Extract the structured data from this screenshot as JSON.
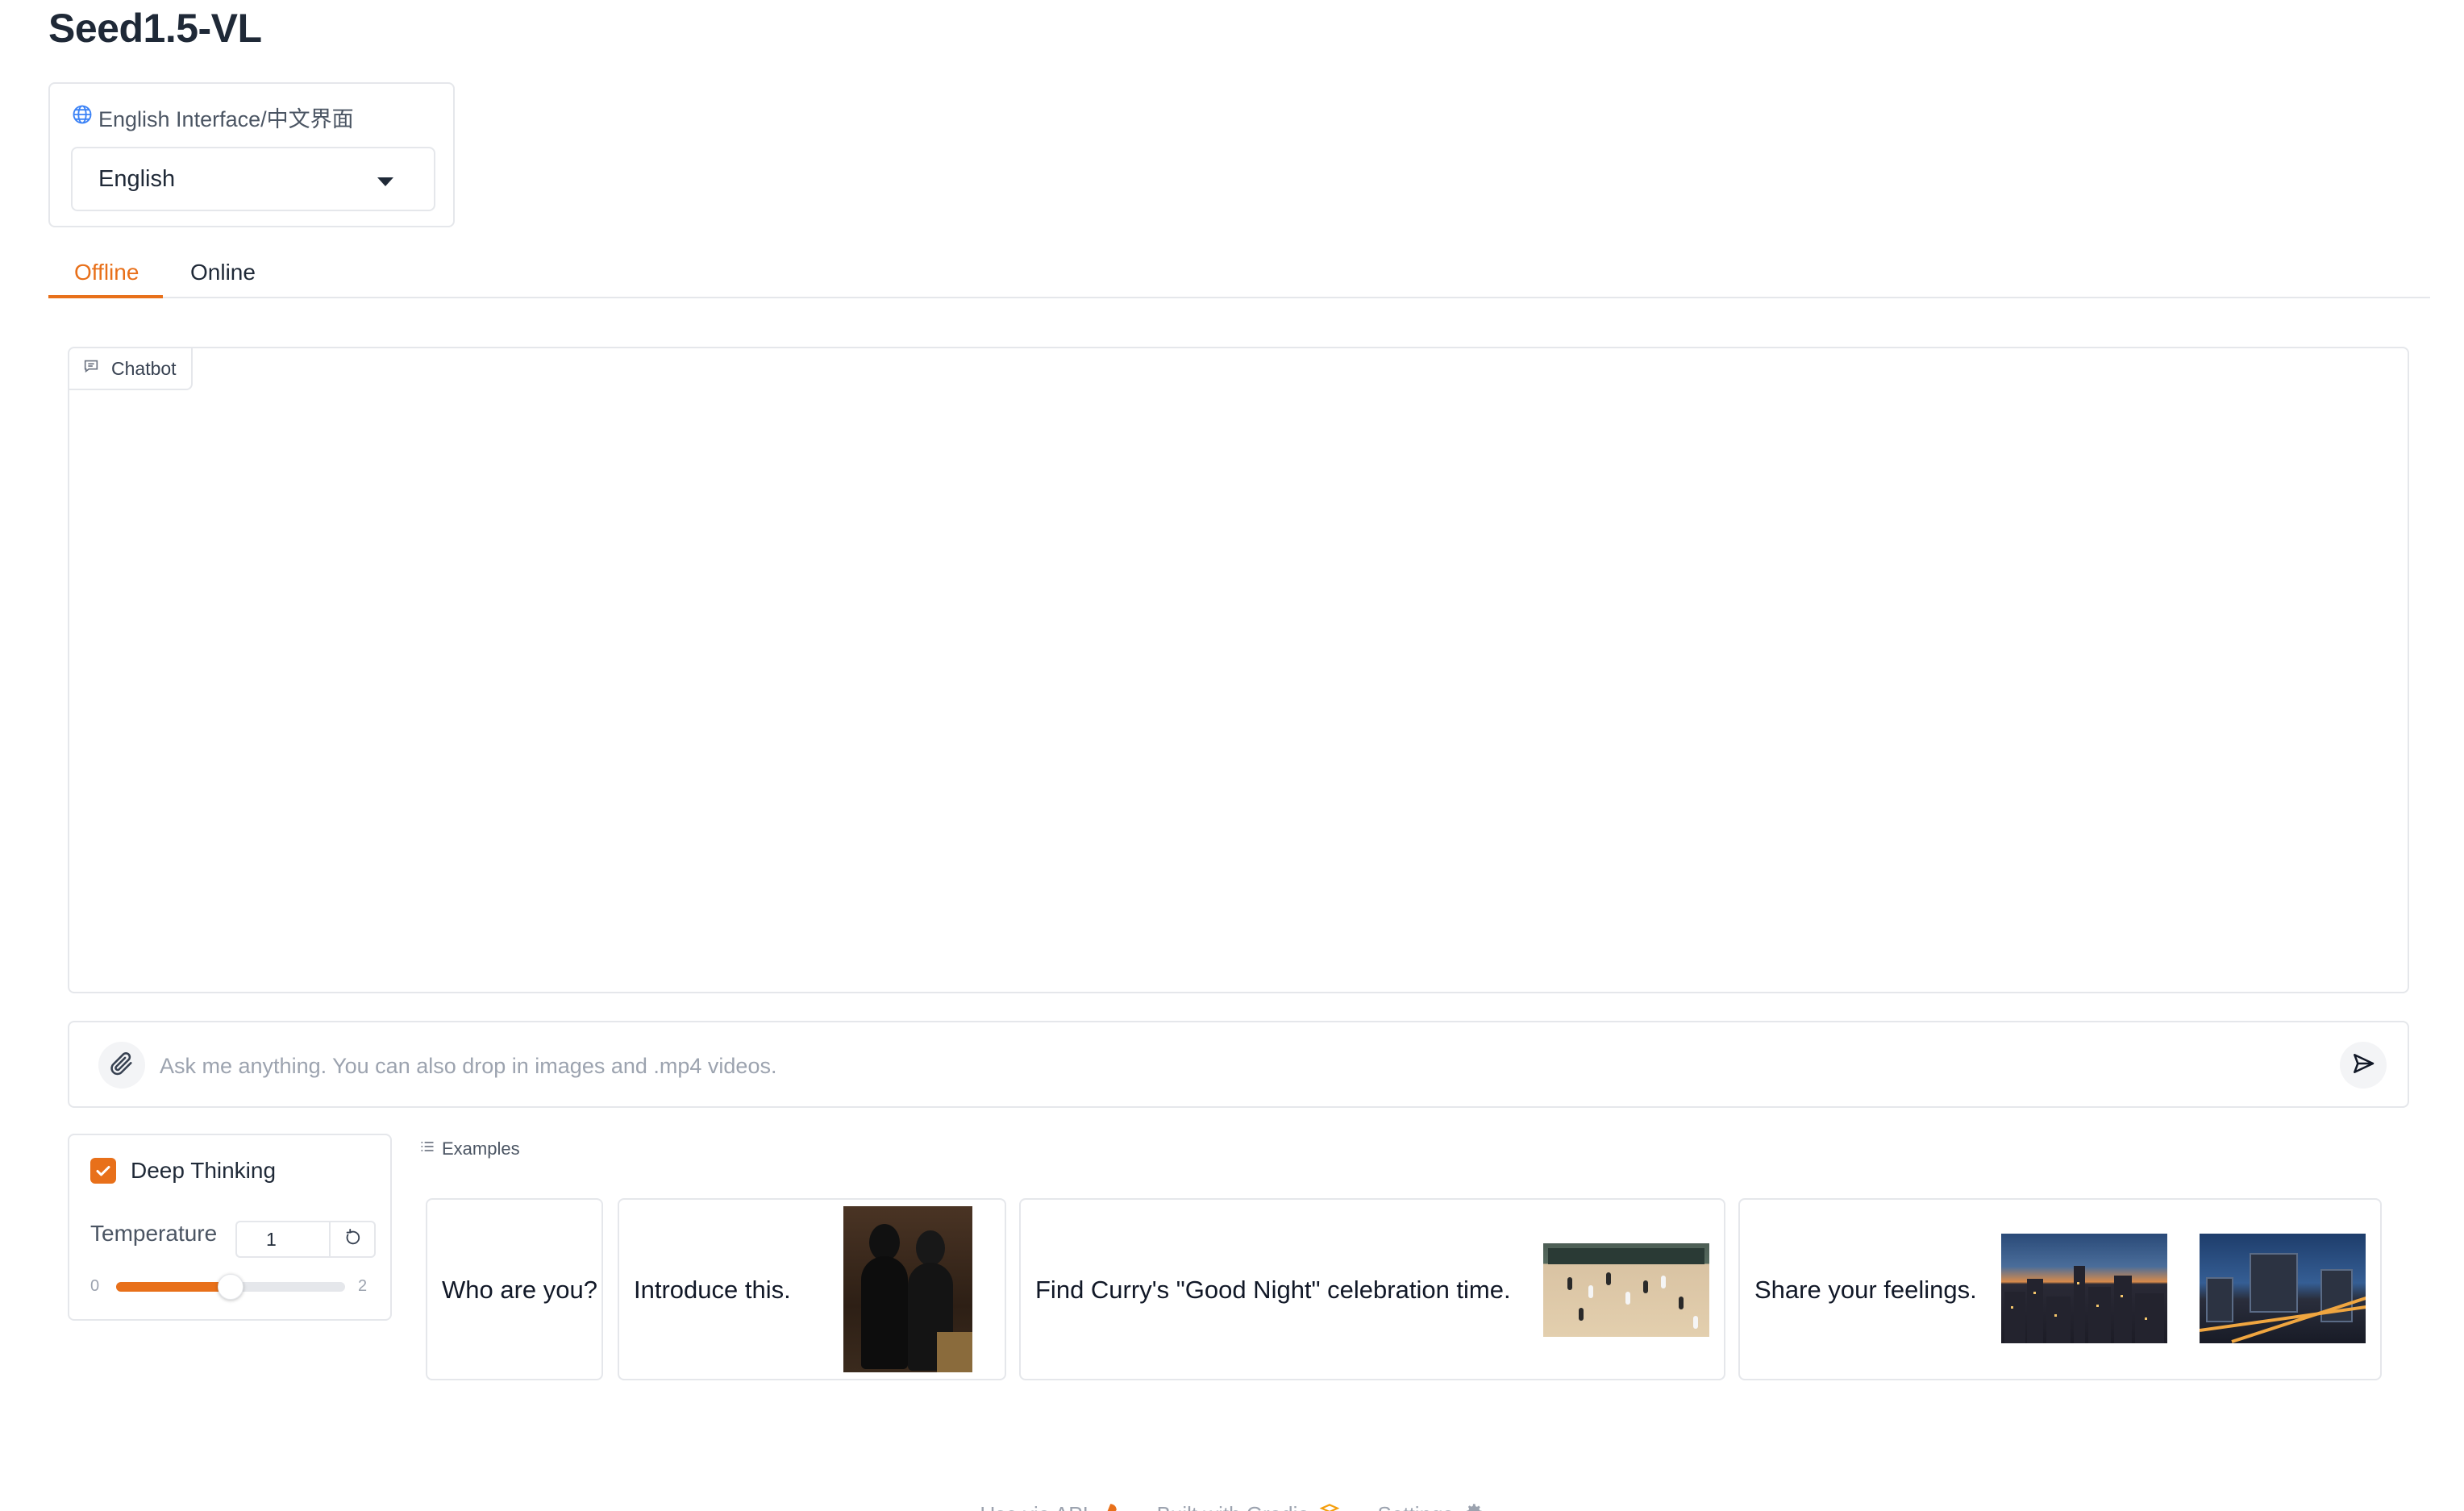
{
  "app": {
    "title": "Seed1.5-VL"
  },
  "language": {
    "label": "English Interface/中文界面",
    "selected": "English",
    "icon": "globe-icon"
  },
  "tabs": [
    {
      "label": "Offline",
      "active": true
    },
    {
      "label": "Online",
      "active": false
    }
  ],
  "chatbot": {
    "label": "Chatbot",
    "icon": "chat-bubble-icon"
  },
  "input": {
    "placeholder": "Ask me anything. You can also drop in images and .mp4 videos.",
    "value": "",
    "attach_icon": "paperclip-icon",
    "send_icon": "send-icon"
  },
  "settings": {
    "deep_thinking_label": "Deep Thinking",
    "deep_thinking_checked": true,
    "temperature_label": "Temperature",
    "temperature_value": "1",
    "slider_min": "0",
    "slider_max": "2",
    "slider_fraction": 0.5
  },
  "examples": {
    "label": "Examples",
    "icon": "list-icon",
    "items": [
      {
        "text": "Who are you?",
        "images": []
      },
      {
        "text": "Introduce this.",
        "images": [
          "painting-thumbnail"
        ]
      },
      {
        "text": "Find Curry's \"Good Night\" celebration time.",
        "images": [
          "basketball-court-thumbnail"
        ]
      },
      {
        "text": "Share your feelings.",
        "images": [
          "city-skyline-thumbnail",
          "city-night-thumbnail"
        ]
      }
    ]
  },
  "footer": {
    "api_label": "Use via API",
    "gradio_label": "Built with Gradio",
    "settings_label": "Settings",
    "separator": "·"
  },
  "colors": {
    "accent": "#e8701a",
    "border": "#e5e7eb",
    "muted": "#9ca3af"
  }
}
